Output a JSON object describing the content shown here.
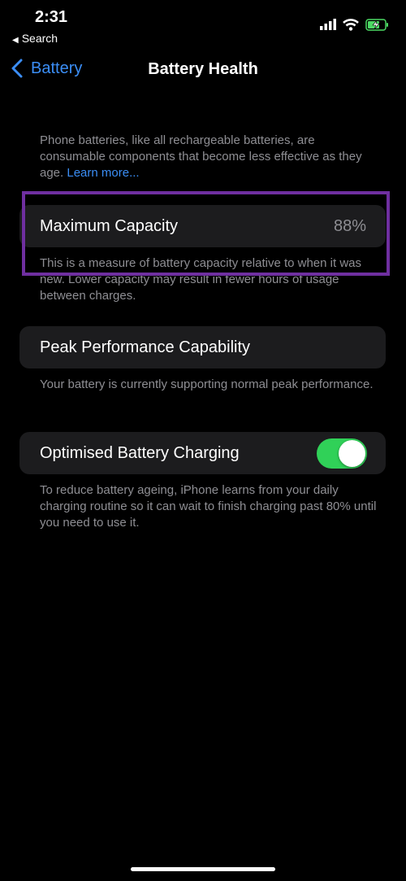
{
  "status_bar": {
    "time": "2:31",
    "back_app": "Search"
  },
  "nav": {
    "back_label": "Battery",
    "title": "Battery Health"
  },
  "intro": {
    "text": "Phone batteries, like all rechargeable batteries, are consumable components that become less effective as they age. ",
    "link": "Learn more..."
  },
  "max_capacity": {
    "label": "Maximum Capacity",
    "value": "88%",
    "footer": "This is a measure of battery capacity relative to when it was new. Lower capacity may result in fewer hours of usage between charges."
  },
  "peak": {
    "label": "Peak Performance Capability",
    "footer": "Your battery is currently supporting normal peak performance."
  },
  "optimised": {
    "label": "Optimised Battery Charging",
    "enabled": true,
    "footer": "To reduce battery ageing, iPhone learns from your daily charging routine so it can wait to finish charging past 80% until you need to use it."
  },
  "colors": {
    "accent": "#3b8ef6",
    "toggle_on": "#30d158",
    "highlight": "#6f2fa0",
    "battery_charging": "#4cd964"
  },
  "icons": [
    "back-arrow-icon",
    "chevron-left-icon",
    "signal-icon",
    "wifi-icon",
    "battery-charging-icon"
  ]
}
